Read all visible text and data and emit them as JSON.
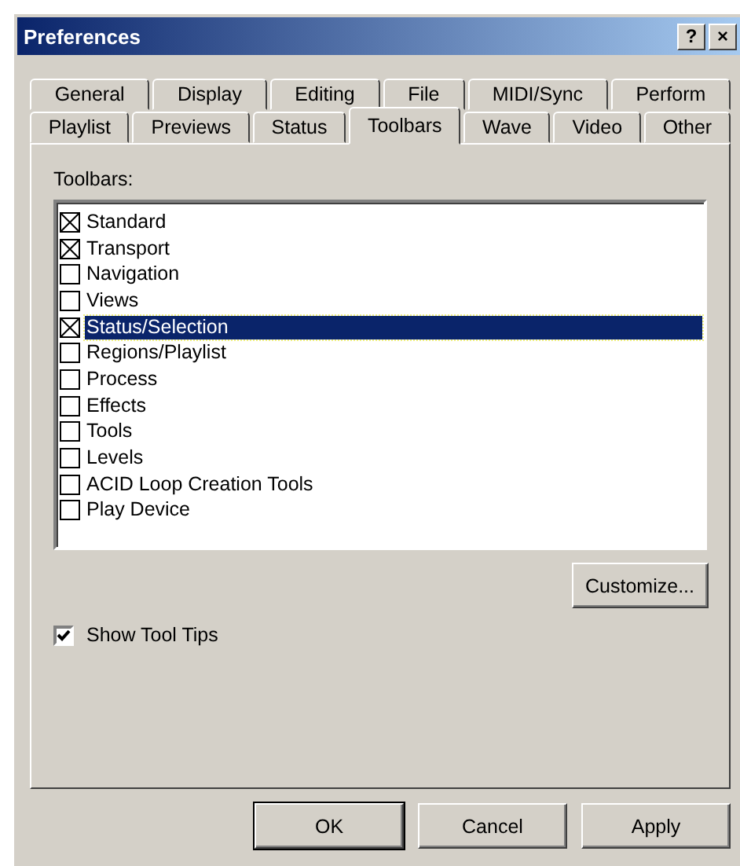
{
  "window": {
    "title": "Preferences",
    "help_button": "?",
    "close_button": "×"
  },
  "tab_rows": [
    [
      {
        "label": "General",
        "selected": false
      },
      {
        "label": "Display",
        "selected": false
      },
      {
        "label": "Editing",
        "selected": false
      },
      {
        "label": "File",
        "selected": false
      },
      {
        "label": "MIDI/Sync",
        "selected": false
      },
      {
        "label": "Perform",
        "selected": false
      }
    ],
    [
      {
        "label": "Playlist",
        "selected": false
      },
      {
        "label": "Previews",
        "selected": false
      },
      {
        "label": "Status",
        "selected": false
      },
      {
        "label": "Toolbars",
        "selected": true
      },
      {
        "label": "Wave",
        "selected": false
      },
      {
        "label": "Video",
        "selected": false
      },
      {
        "label": "Other",
        "selected": false
      }
    ]
  ],
  "toolbars": {
    "label": "Toolbars:",
    "items": [
      {
        "label": "Standard",
        "checked": true,
        "selected": false
      },
      {
        "label": "Transport",
        "checked": true,
        "selected": false
      },
      {
        "label": "Navigation",
        "checked": false,
        "selected": false
      },
      {
        "label": "Views",
        "checked": false,
        "selected": false
      },
      {
        "label": "Status/Selection",
        "checked": true,
        "selected": true
      },
      {
        "label": "Regions/Playlist",
        "checked": false,
        "selected": false
      },
      {
        "label": "Process",
        "checked": false,
        "selected": false
      },
      {
        "label": "Effects",
        "checked": false,
        "selected": false
      },
      {
        "label": "Tools",
        "checked": false,
        "selected": false
      },
      {
        "label": "Levels",
        "checked": false,
        "selected": false
      },
      {
        "label": "ACID Loop Creation Tools",
        "checked": false,
        "selected": false
      },
      {
        "label": "Play Device",
        "checked": false,
        "selected": false
      }
    ]
  },
  "customize_button": "Customize...",
  "show_tool_tips": {
    "label": "Show Tool Tips",
    "checked": true
  },
  "buttons": [
    {
      "label": "OK",
      "default": true
    },
    {
      "label": "Cancel",
      "default": false
    },
    {
      "label": "Apply",
      "default": false
    }
  ]
}
